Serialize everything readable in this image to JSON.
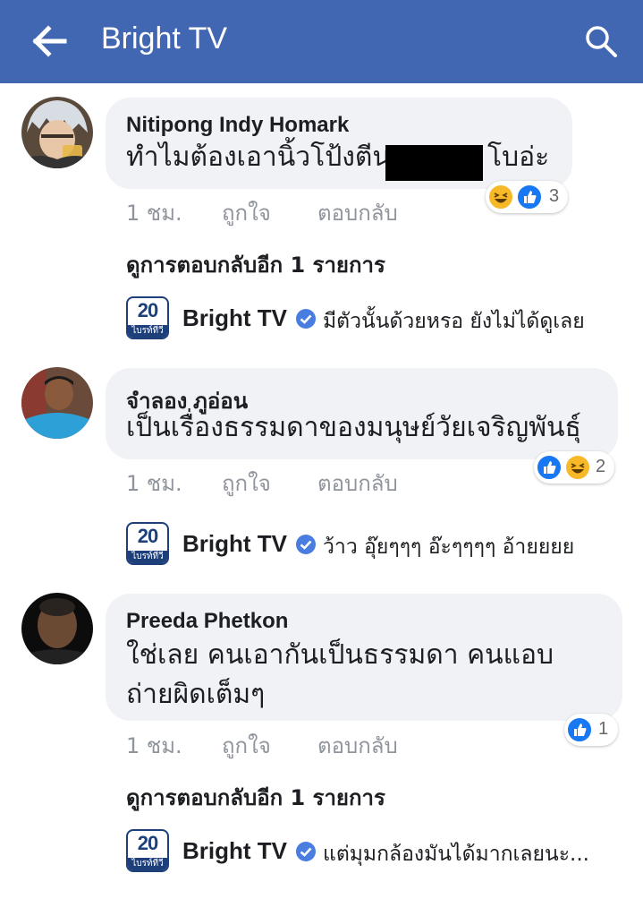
{
  "header": {
    "title": "Bright TV",
    "back_icon": "arrow-left-icon",
    "search_icon": "search-icon",
    "background": "#4267b2"
  },
  "comments": [
    {
      "author": "Nitipong Indy Homark",
      "text_before": "ทำไมต้องเอานิ้วโป้งตีนเ",
      "text_after": "โบอ่ะ",
      "time": "1 ชม.",
      "like_label": "ถูกใจ",
      "reply_label": "ตอบกลับ",
      "reaction_count": "3",
      "more_replies": "ดูการตอบกลับอีก 1 รายการ",
      "reply": {
        "page_name": "Bright TV",
        "text": "มีตัวนั้นด้วยหรอ ยังไม่ได้ดูเลย"
      }
    },
    {
      "author": "จำลอง ภูอ่อน",
      "text": "เป็นเรื่องธรรมดาของมนุษย์วัยเจริญพันธุ์",
      "time": "1 ชม.",
      "like_label": "ถูกใจ",
      "reply_label": "ตอบกลับ",
      "reaction_count": "2",
      "reply": {
        "page_name": "Bright TV",
        "text": "ว้าว อุ๊ยๆๆๆ อ๊ะๆๆๆๆ อ้ายยยย"
      }
    },
    {
      "author": "Preeda Phetkon",
      "text_line1": "ใช่เลย คนเอากันเป็นธรรมดา คนแอบ",
      "text_line2": "ถ่ายผิดเต็มๆ",
      "time": "1 ชม.",
      "like_label": "ถูกใจ",
      "reply_label": "ตอบกลับ",
      "reaction_count": "1",
      "more_replies": "ดูการตอบกลับอีก 1 รายการ",
      "reply": {
        "page_name": "Bright TV",
        "text": "แต่มุมกล้องมันได้มากเลยนะ..."
      }
    }
  ],
  "page_logo": {
    "number": "20",
    "caption": "ไบรท์ทีวี"
  },
  "colors": {
    "like": "#1877f2",
    "haha": "#f7b928",
    "bubble": "#f0f2f5",
    "meta_text": "#90949c"
  }
}
